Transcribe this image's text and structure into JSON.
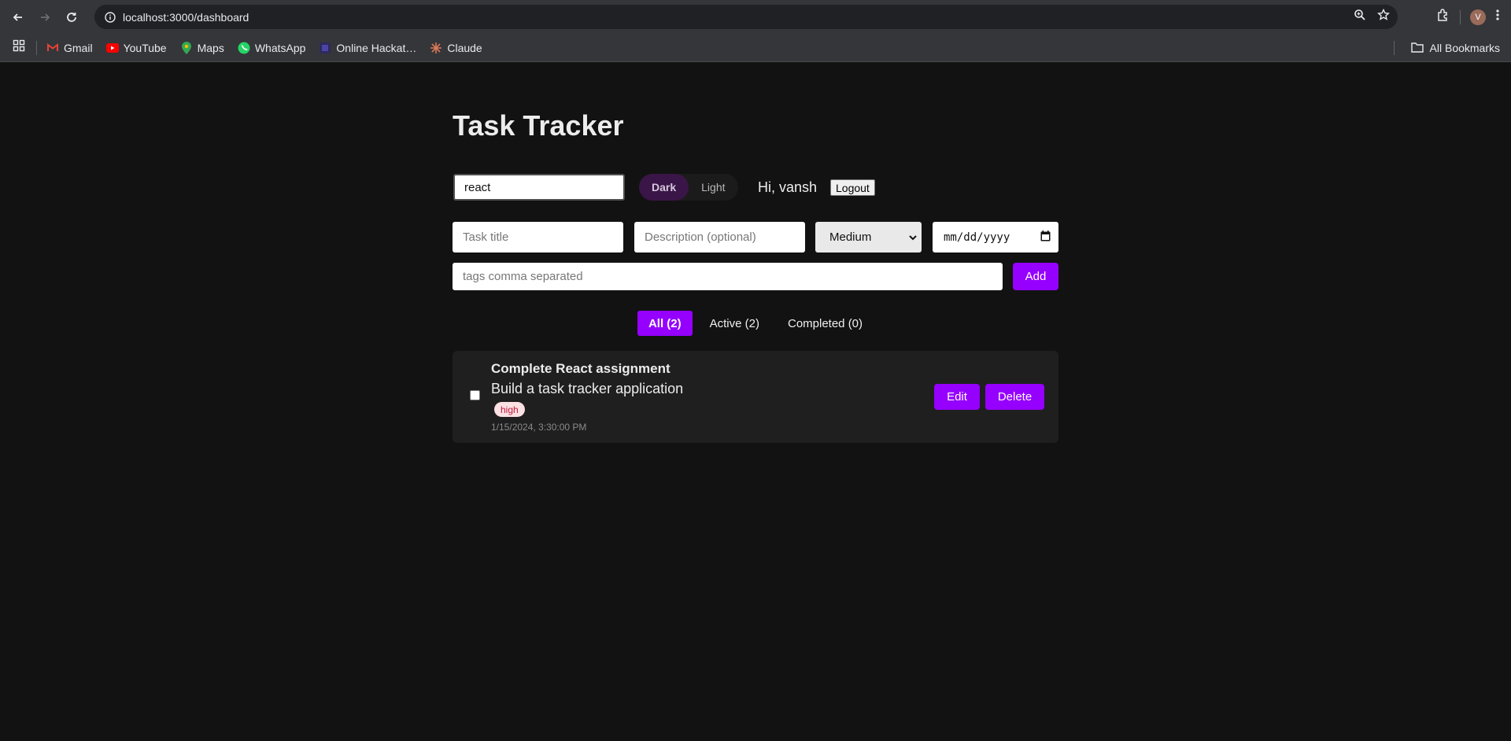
{
  "browser": {
    "url": "localhost:3000/dashboard",
    "profile_initial": "V",
    "bookmarks": [
      {
        "label": "Gmail",
        "icon": "gmail-icon"
      },
      {
        "label": "YouTube",
        "icon": "youtube-icon"
      },
      {
        "label": "Maps",
        "icon": "maps-icon"
      },
      {
        "label": "WhatsApp",
        "icon": "whatsapp-icon"
      },
      {
        "label": "Online Hackat…",
        "icon": "hackathon-icon"
      },
      {
        "label": "Claude",
        "icon": "claude-icon"
      }
    ],
    "all_bookmarks_label": "All Bookmarks"
  },
  "app": {
    "title": "Task Tracker",
    "search_value": "react",
    "theme": {
      "dark_label": "Dark",
      "light_label": "Light",
      "selected": "Dark"
    },
    "greeting": "Hi, vansh",
    "logout_label": "Logout",
    "form": {
      "title_placeholder": "Task title",
      "description_placeholder": "Description (optional)",
      "priority_value": "Medium",
      "date_placeholder": "mm/dd/yyyy",
      "tags_placeholder": "tags comma separated",
      "add_label": "Add"
    },
    "filters": [
      {
        "label": "All (2)",
        "active": true
      },
      {
        "label": "Active (2)",
        "active": false
      },
      {
        "label": "Completed (0)",
        "active": false
      }
    ],
    "tasks": [
      {
        "title": "Complete React assignment",
        "description": "Build a task tracker application",
        "tag": "high",
        "date": "1/15/2024, 3:30:00 PM",
        "completed": false,
        "edit_label": "Edit",
        "delete_label": "Delete"
      }
    ]
  },
  "colors": {
    "background": "#121212",
    "accent": "#9500ff",
    "card": "#1f1f1f",
    "tag_bg": "#fbe1e4",
    "tag_text": "#c0183d"
  }
}
